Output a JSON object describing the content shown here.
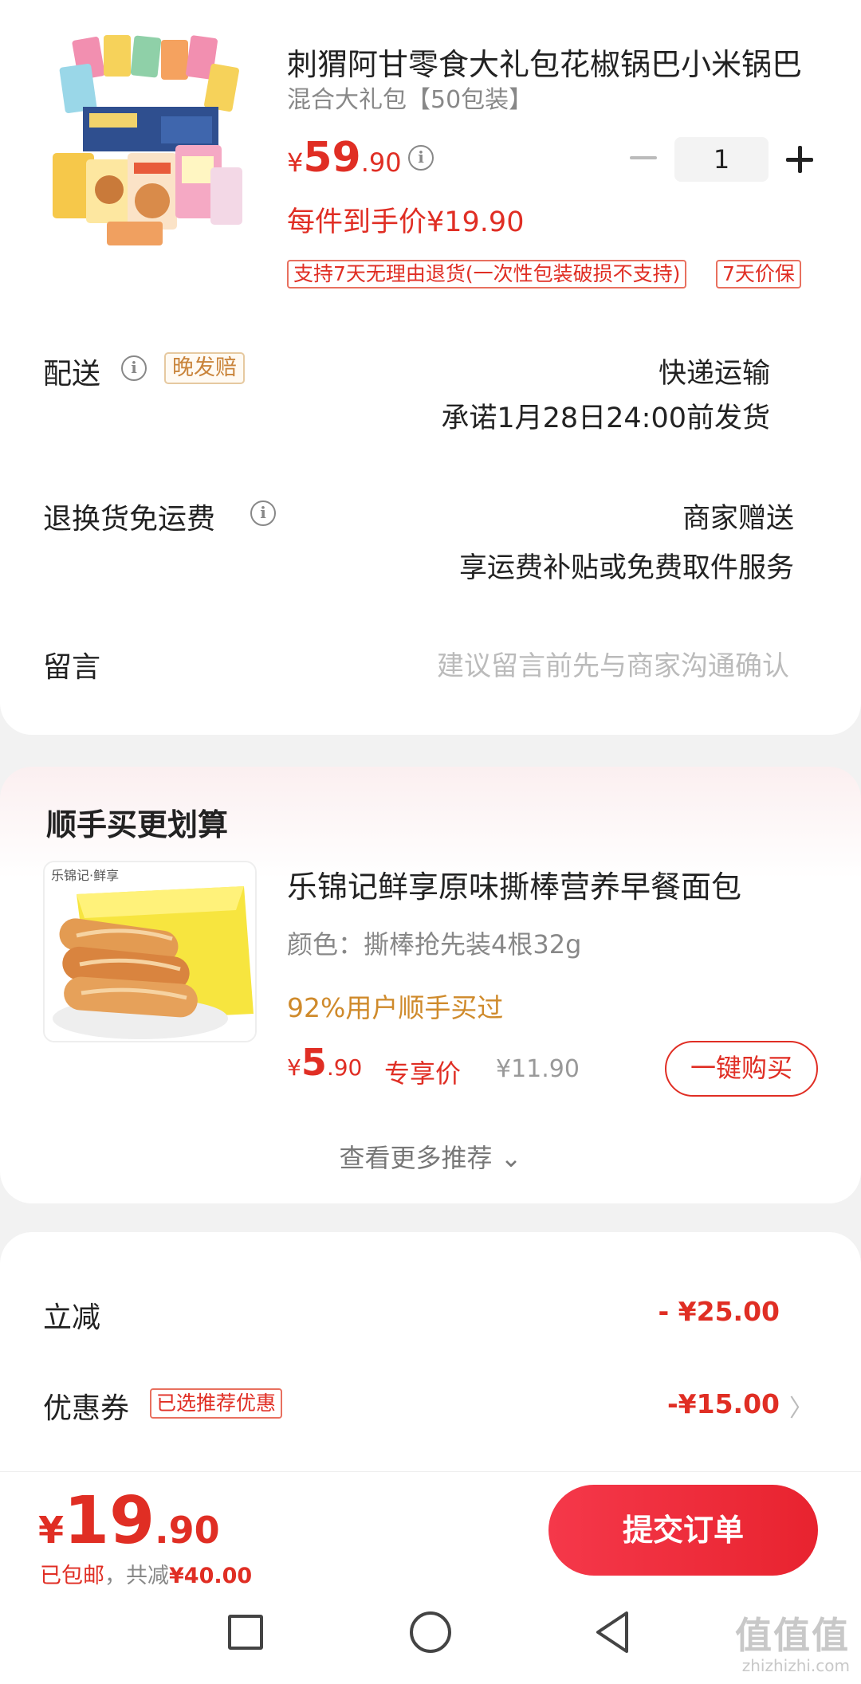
{
  "product": {
    "title": "刺猬阿甘零食大礼包花椒锅巴小米锅巴",
    "spec": "混合大礼包【50包装】",
    "price_currency": "¥",
    "price_int": "59",
    "price_dec": ".90",
    "quantity": "1",
    "per_price": "每件到手价¥19.90",
    "tag_return": "支持7天无理由退货(一次性包装破损不支持)",
    "tag_price_protect": "7天价保"
  },
  "delivery": {
    "label": "配送",
    "badge": "晚发赔",
    "method": "快递运输",
    "promise": "承诺1月28日24:00前发货"
  },
  "return_shipping": {
    "label": "退换货免运费",
    "value_line1": "商家赠送",
    "value_line2": "享运费补贴或免费取件服务"
  },
  "message": {
    "label": "留言",
    "placeholder": "建议留言前先与商家沟通确认"
  },
  "recommend": {
    "section_title": "顺手买更划算",
    "title": "乐锦记鲜享原味撕棒营养早餐面包",
    "spec": "颜色：撕棒抢先装4根32g",
    "social": "92%用户顺手买过",
    "price_currency": "¥",
    "price_int": "5",
    "price_dec": ".90",
    "exclusive_label": "专享价",
    "original_price": "¥11.90",
    "buy_button": "一键购买",
    "more_link": "查看更多推荐 ⌄",
    "thumb_brand": "乐锦记·鲜享"
  },
  "discounts": {
    "instant_label": "立减",
    "instant_value": "- ¥25.00",
    "coupon_label": "优惠券",
    "coupon_tag": "已选推荐优惠",
    "coupon_value": "-¥15.00"
  },
  "checkout": {
    "total_currency": "¥",
    "total_int": "19",
    "total_dec": ".90",
    "free_shipping": "已包邮",
    "saved_prefix": "，共减",
    "saved_amount": "¥40.00",
    "submit_button": "提交订单"
  },
  "watermark": {
    "big": "值值值",
    "small": "zhizhizhi.com"
  },
  "colors": {
    "accent_red": "#e02e24",
    "gold": "#cf8a2b",
    "gray_text": "#888888"
  }
}
